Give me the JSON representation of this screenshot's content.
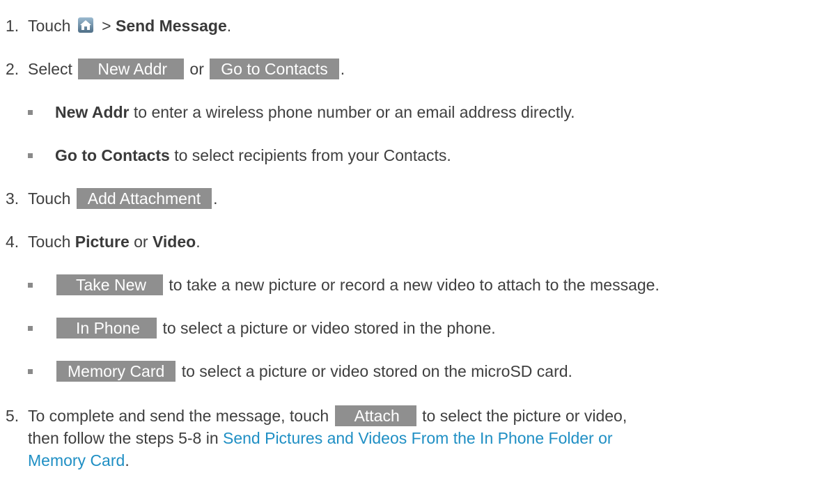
{
  "steps": [
    {
      "number": "1.",
      "pre": "Touch",
      "mid": " > ",
      "bold": "Send Message",
      "post": "."
    },
    {
      "number": "2.",
      "pre": "Select",
      "key1": "New Addr",
      "or": " or ",
      "key2": "Go to Contacts",
      "post": ".",
      "bullets": [
        {
          "bold": "New Addr",
          "text": " to enter a wireless phone number or an email address directly."
        },
        {
          "bold": "Go to Contacts",
          "text": " to select recipients from your Contacts."
        }
      ]
    },
    {
      "number": "3.",
      "pre": "Touch",
      "key": "Add Attachment",
      "post": "."
    },
    {
      "number": "4.",
      "pre": "Touch ",
      "bold1": "Picture",
      "or": " or ",
      "bold2": "Video",
      "post": ".",
      "bullets": [
        {
          "key": "Take New",
          "text": " to take a new picture or record a new video to attach to the message."
        },
        {
          "key": "In Phone",
          "text": " to select a picture or video stored in the phone."
        },
        {
          "key": "Memory Card",
          "text": " to select a picture or video stored on the microSD card."
        }
      ]
    },
    {
      "number": "5.",
      "pre": "To complete and send the message, touch",
      "key": "Attach",
      "post": " to select the picture or video,",
      "line2_pre": "then follow the steps 5-8 in ",
      "link_part1": "Send Pictures and Videos From the In Phone Folder or",
      "link_part2": "Memory Card",
      "end": "."
    }
  ],
  "icons": {
    "home": "home-icon"
  },
  "colors": {
    "text": "#3f3f3f",
    "key_bg": "#8f8f8f",
    "key_text": "#ffffff",
    "link": "#1f8fc4",
    "bullet": "#8a8a8a"
  }
}
